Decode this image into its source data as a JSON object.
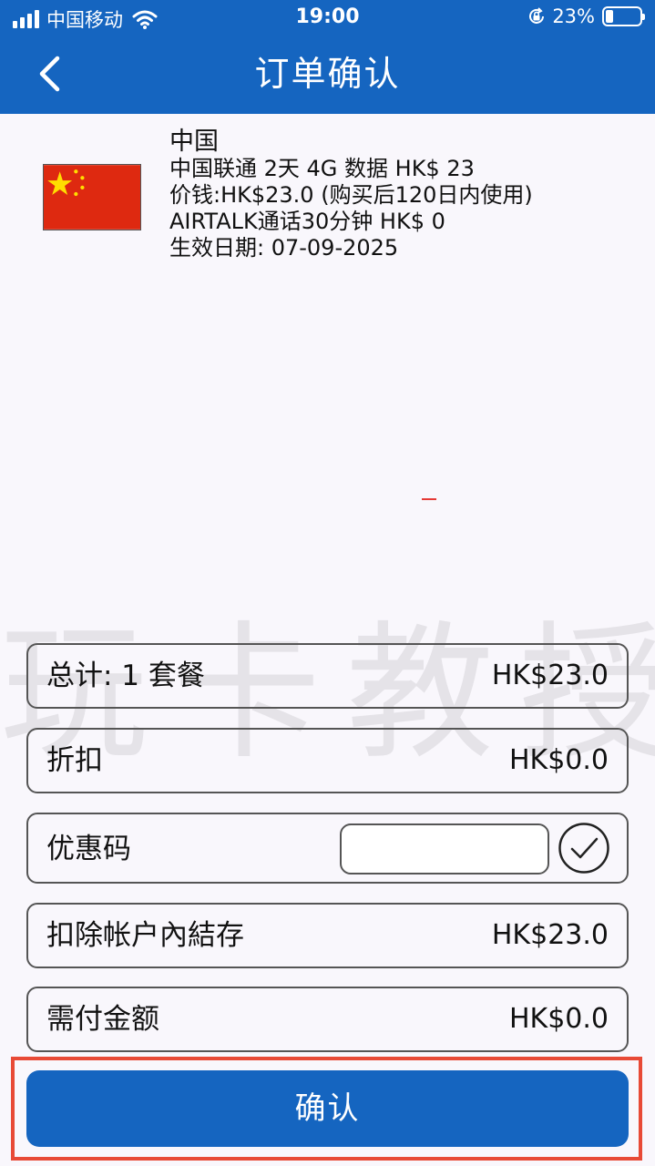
{
  "status_bar": {
    "carrier": "中国移动",
    "time": "19:00",
    "battery_percent": "23%",
    "battery_level": 0.23,
    "signal_icon": "signal-bars-icon",
    "wifi_icon": "wifi-icon",
    "rotation_lock_icon": "rotation-lock-icon"
  },
  "header": {
    "title": "订单确认",
    "back_icon": "chevron-left-icon"
  },
  "product": {
    "flag_icon": "china-flag-icon",
    "country": "中国",
    "plan": "中国联通 2天 4G 数据 HK$ 23",
    "price": "价钱:HK$23.0 (购买后120日内使用)",
    "airtalk": "AIRTALK通话30分钟 HK$ 0",
    "effective_date": "生效日期: 07-09-2025"
  },
  "watermark": "玩卡教授",
  "summary": {
    "total_label": "总计: 1 套餐",
    "total_value": "HK$23.0",
    "discount_label": "折扣",
    "discount_value": "HK$0.0",
    "promo_label": "优惠码",
    "promo_value": "",
    "promo_check_icon": "check-circle-icon",
    "balance_label": "扣除帐户內結存",
    "balance_value": "HK$23.0",
    "payable_label": "需付金额",
    "payable_value": "HK$0.0"
  },
  "confirm_label": "确认",
  "colors": {
    "primary": "#1565c0",
    "background": "#f9f7fc",
    "highlight": "#e84a36",
    "flag_red": "#de2910",
    "flag_yellow": "#ffde00"
  }
}
